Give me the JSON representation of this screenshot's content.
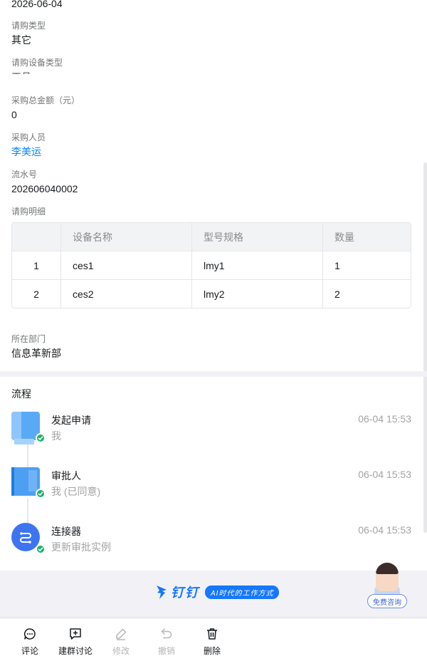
{
  "form": {
    "date_value": "2026-06-04",
    "purchase_type": {
      "label": "请购类型",
      "value": "其它"
    },
    "device_type": {
      "label": "请购设备类型",
      "value": "工具"
    },
    "total_amount": {
      "label": "采购总金额（元）",
      "value": "0"
    },
    "purchaser": {
      "label": "采购人员",
      "value": "李美运"
    },
    "serial_no": {
      "label": "流水号",
      "value": "202606040002"
    },
    "detail": {
      "label": "请购明细",
      "headers": [
        "",
        "设备名称",
        "型号规格",
        "数量"
      ],
      "rows": [
        [
          "1",
          "ces1",
          "lmy1",
          "1"
        ],
        [
          "2",
          "ces2",
          "lmy2",
          "2"
        ]
      ]
    },
    "department": {
      "label": "所在部门",
      "value": "信息革新部"
    }
  },
  "flow": {
    "title": "流程",
    "nodes": [
      {
        "title": "发起申请",
        "sub": "我",
        "time": "06-04 15:53"
      },
      {
        "title": "审批人",
        "sub": "我 (已同意)",
        "time": "06-04 15:53"
      },
      {
        "title": "连接器",
        "sub": "更新审批实例",
        "time": "06-04 15:53"
      }
    ]
  },
  "brand": {
    "name": "钉钉",
    "slogan": "AI时代的工作方式",
    "accent": "#1677ff",
    "consult_label": "免费咨询"
  },
  "bottom_nav": [
    {
      "label": "评论",
      "icon": "comment-icon",
      "enabled": true
    },
    {
      "label": "建群讨论",
      "icon": "group-chat-icon",
      "enabled": true
    },
    {
      "label": "修改",
      "icon": "edit-icon",
      "enabled": false
    },
    {
      "label": "撤销",
      "icon": "undo-icon",
      "enabled": false
    },
    {
      "label": "删除",
      "icon": "trash-icon",
      "enabled": true
    }
  ]
}
